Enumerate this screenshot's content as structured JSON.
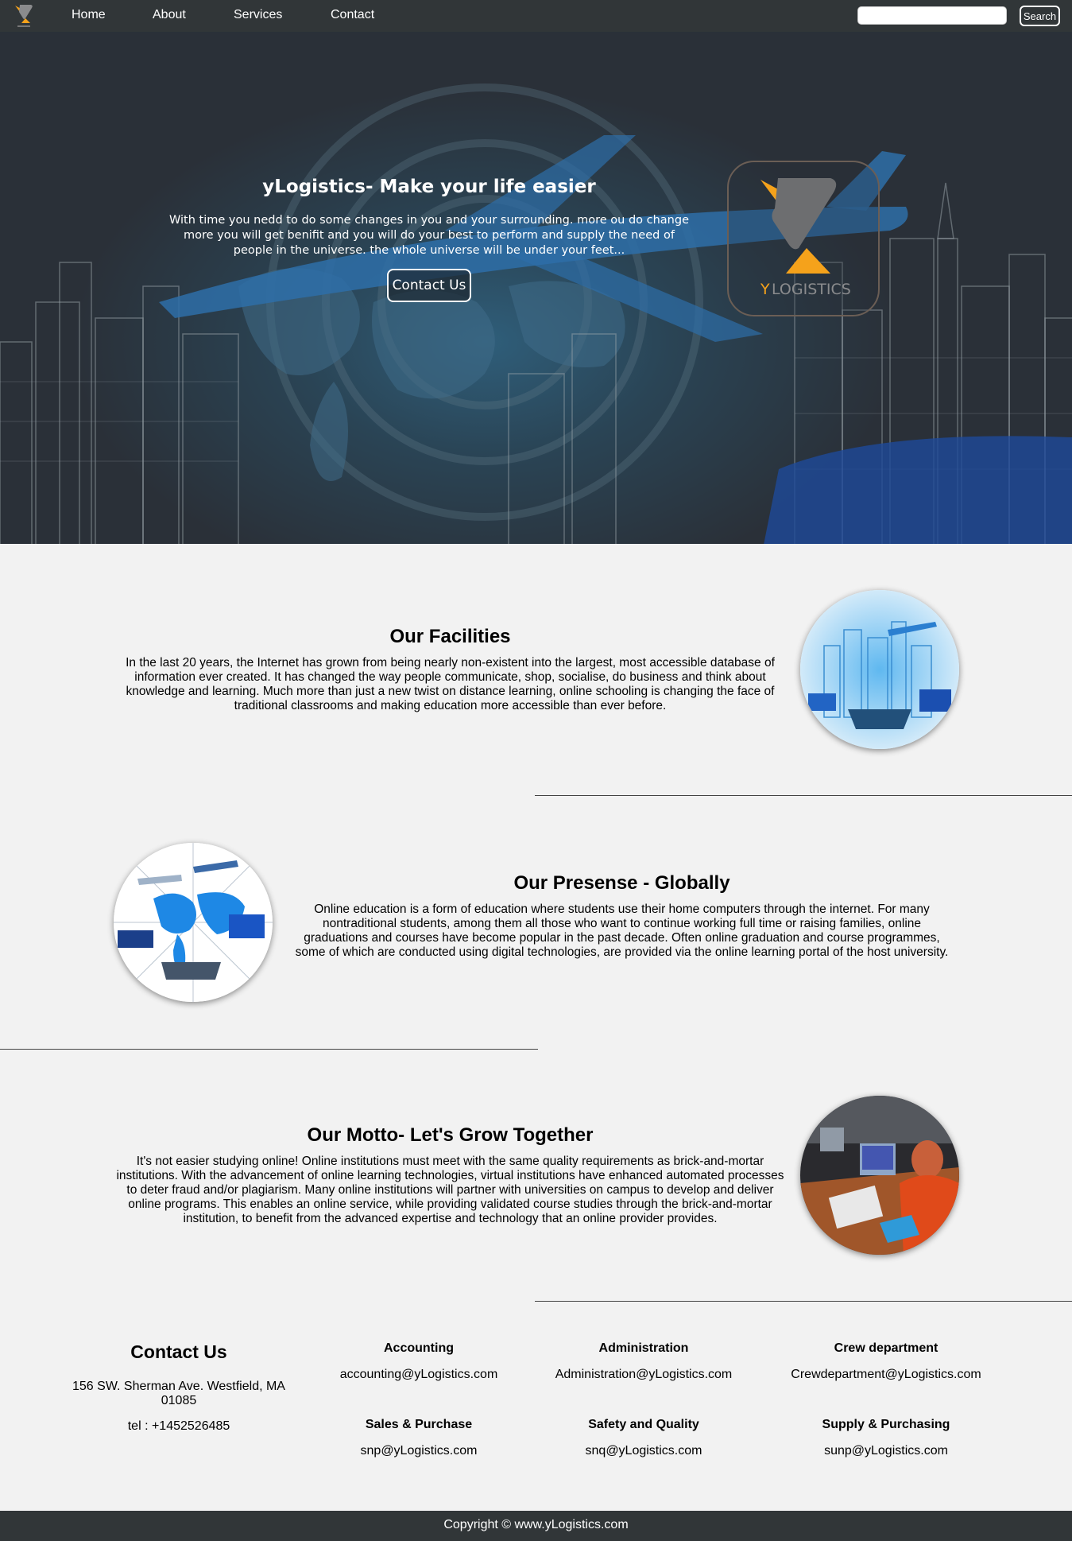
{
  "nav": {
    "links": [
      "Home",
      "About",
      "Services",
      "Contact"
    ],
    "search_placeholder": "",
    "search_button": "Search"
  },
  "hero": {
    "title": "yLogistics- Make your life easier",
    "text": "With time you nedd to do some changes in you and your surrounding. more ou do change more you will get benifit and you will do your best to perform and supply the need of people in the universe. the whole universe will be under your feet...",
    "button": "Contact Us",
    "logo_text_y": "Y",
    "logo_text_rest": "LOGISTICS"
  },
  "sections": [
    {
      "title": "Our Facilities",
      "text": "In the last 20 years, the Internet has grown from being nearly non-existent into the largest, most accessible database of information ever created. It has changed the way people communicate, shop, socialise, do business and think about knowledge and learning. Much more than just a new twist on distance learning, online schooling is changing the face of traditional classrooms and making education more accessible than ever before."
    },
    {
      "title": "Our Presense - Globally",
      "text": "Online education is a form of education where students use their home computers through the internet. For many nontraditional students, among them all those who want to continue working full time or raising families, online graduations and courses have become popular in the past decade. Often online graduation and course programmes, some of which are conducted using digital technologies, are provided via the online learning portal of the host university."
    },
    {
      "title": "Our Motto- Let's Grow Together",
      "text": "It's not easier studying online! Online institutions must meet with the same quality requirements as brick-and-mortar institutions. With the advancement of online learning technologies, virtual institutions have enhanced automated processes to deter fraud and/or plagiarism. Many online institutions will partner with universities on campus to develop and deliver online programs. This enables an online service, while providing validated course studies through the brick-and-mortar institution, to benefit from the advanced expertise and technology that an online provider provides."
    }
  ],
  "contact": {
    "title": "Contact Us",
    "address": "156 SW. Sherman Ave. Westfield, MA 01085",
    "tel": "tel : +1452526485",
    "departments": [
      {
        "name": "Accounting",
        "email": "accounting@yLogistics.com"
      },
      {
        "name": "Administration",
        "email": "Administration@yLogistics.com"
      },
      {
        "name": "Crew department",
        "email": "Crewdepartment@yLogistics.com"
      },
      {
        "name": "Sales & Purchase",
        "email": "snp@yLogistics.com"
      },
      {
        "name": "Safety and Quality",
        "email": "snq@yLogistics.com"
      },
      {
        "name": "Supply & Purchasing",
        "email": "sunp@yLogistics.com"
      }
    ]
  },
  "footer": {
    "copyright": "Copyright © www.yLogistics.com"
  },
  "colors": {
    "nav_bg": "#313638",
    "page_bg": "#f2f2f2",
    "brand_orange": "#f5a21b",
    "brand_gray": "#6d6e70"
  }
}
